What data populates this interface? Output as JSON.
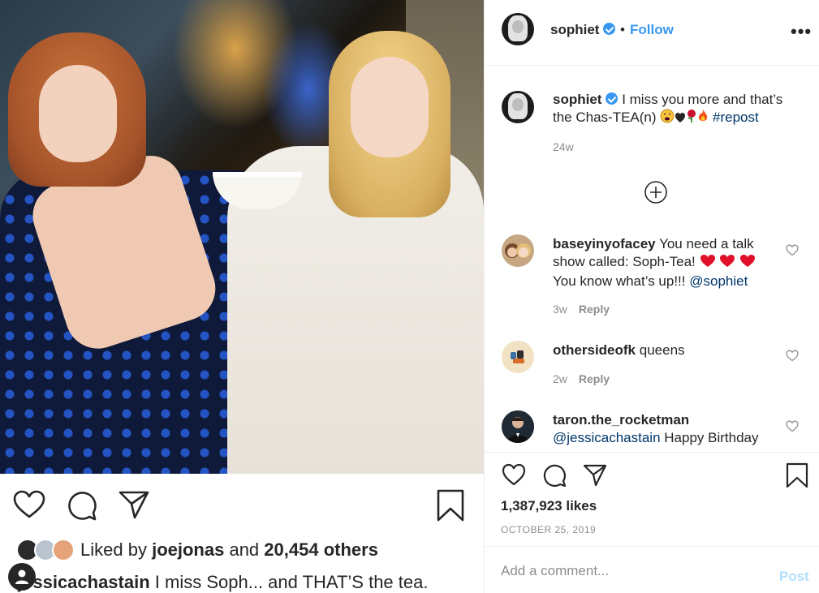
{
  "post": {
    "username": "sophiet",
    "dot": "•",
    "follow_label": "Follow",
    "more_label": "•••",
    "caption_text": "I miss you more and that’s the Chas-TEA(n)",
    "caption_emojis": [
      "weary-face",
      "black-heart",
      "rose",
      "fire"
    ],
    "caption_hashtag": "#repost",
    "caption_age": "24w",
    "likes": "1,387,923 likes",
    "date": "OCTOBER 25, 2019",
    "comment_placeholder": "Add a comment...",
    "post_label": "Post"
  },
  "comments": [
    {
      "username": "baseyinyofacey",
      "text_part1": "You need a talk show called: Soph-Tea!",
      "emojis": [
        "red-heart",
        "red-heart",
        "red-heart"
      ],
      "text_part2": "You know what’s up!!!",
      "mention": "@sophiet",
      "age": "3w",
      "reply_label": "Reply"
    },
    {
      "username": "othersideofk",
      "text": "queens",
      "age": "2w",
      "reply_label": "Reply"
    },
    {
      "username": "taron.the_rocketman",
      "mention": "@jessicachastain",
      "text": "Happy Birthday"
    }
  ],
  "embed": {
    "liked_by_prefix": "Liked by",
    "liked_by_user": "joejonas",
    "liked_by_and": "and",
    "liked_by_others": "20,454 others",
    "caption_user": "jessicachastain",
    "caption_text": "I miss Soph... and THAT’S the tea."
  },
  "colors": {
    "accent_blue": "#3897f0",
    "link_navy": "#00376b",
    "muted_gray": "#8e8e8e",
    "text_dark": "#262626",
    "heart_red": "#ed4956",
    "post_disabled": "#b2dffc"
  }
}
